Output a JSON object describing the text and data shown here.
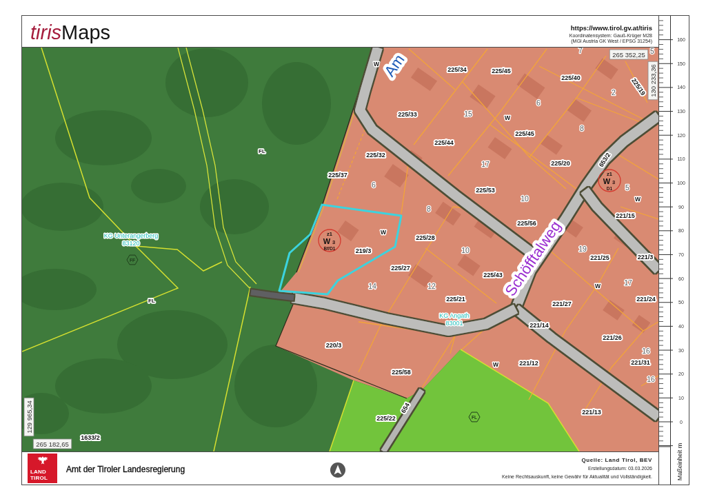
{
  "header": {
    "logo": {
      "prefix": "tiris",
      "suffix": "Maps"
    },
    "url": "https://www.tirol.gv.at/tiris",
    "coordinate_system": [
      "Koordinatensystem: Gauß-Krüger M28",
      "(MGI Austria GK West / EPSG 31254)"
    ]
  },
  "map": {
    "street_labels": [
      {
        "text": "Am",
        "color": "#1e5bb8"
      },
      {
        "text": "Schöfftalweg",
        "color": "#9a2fd0"
      }
    ],
    "labels": [
      {
        "kind": "house",
        "text": "7"
      },
      {
        "kind": "house",
        "text": "5"
      },
      {
        "kind": "zone",
        "text": "W"
      },
      {
        "kind": "parcel",
        "text": "225/34"
      },
      {
        "kind": "parcel",
        "text": "225/45"
      },
      {
        "kind": "parcel",
        "text": "225/40"
      },
      {
        "kind": "parcel",
        "text": "225/19"
      },
      {
        "kind": "house",
        "text": "2"
      },
      {
        "kind": "house",
        "text": "6"
      },
      {
        "kind": "parcel",
        "text": "225/33"
      },
      {
        "kind": "house",
        "text": "15"
      },
      {
        "kind": "zone",
        "text": "W"
      },
      {
        "kind": "house",
        "text": "8"
      },
      {
        "kind": "parcel",
        "text": "225/45"
      },
      {
        "kind": "parcel",
        "text": "225/44"
      },
      {
        "kind": "code",
        "text": "FL"
      },
      {
        "kind": "parcel",
        "text": "225/32"
      },
      {
        "kind": "house",
        "text": "17"
      },
      {
        "kind": "parcel",
        "text": "225/20"
      },
      {
        "kind": "parcel",
        "text": "653/2"
      },
      {
        "kind": "parcel",
        "text": "225/37"
      },
      {
        "kind": "house",
        "text": "6"
      },
      {
        "kind": "parcel",
        "text": "225/53"
      },
      {
        "kind": "house",
        "text": "5"
      },
      {
        "kind": "house",
        "text": "10"
      },
      {
        "kind": "zone",
        "text": "W"
      },
      {
        "kind": "house",
        "text": "8"
      },
      {
        "kind": "parcel",
        "text": "221/15"
      },
      {
        "kind": "parcel",
        "text": "225/56"
      },
      {
        "kind": "zone",
        "text": "W"
      },
      {
        "kind": "parcel",
        "text": "225/28"
      },
      {
        "kind": "parcel",
        "text": "219/3"
      },
      {
        "kind": "house",
        "text": "10"
      },
      {
        "kind": "house",
        "text": "19"
      },
      {
        "kind": "parcel",
        "text": "221/25"
      },
      {
        "kind": "parcel",
        "text": "221/3"
      },
      {
        "kind": "parcel",
        "text": "225/27"
      },
      {
        "kind": "parcel",
        "text": "225/43"
      },
      {
        "kind": "house",
        "text": "14"
      },
      {
        "kind": "house",
        "text": "12"
      },
      {
        "kind": "zone",
        "text": "W"
      },
      {
        "kind": "house",
        "text": "17"
      },
      {
        "kind": "code",
        "text": "FL"
      },
      {
        "kind": "parcel",
        "text": "225/21"
      },
      {
        "kind": "parcel",
        "text": "221/27"
      },
      {
        "kind": "parcel",
        "text": "221/24"
      },
      {
        "kind": "parcel",
        "text": "221/14"
      },
      {
        "kind": "parcel",
        "text": "220/3"
      },
      {
        "kind": "parcel",
        "text": "221/26"
      },
      {
        "kind": "house",
        "text": "16"
      },
      {
        "kind": "zone",
        "text": "W"
      },
      {
        "kind": "parcel",
        "text": "221/12"
      },
      {
        "kind": "parcel",
        "text": "221/31"
      },
      {
        "kind": "parcel",
        "text": "225/58"
      },
      {
        "kind": "house",
        "text": "16"
      },
      {
        "kind": "parcel",
        "text": "225/22"
      },
      {
        "kind": "parcel",
        "text": "654"
      },
      {
        "kind": "parcel",
        "text": "221/13"
      },
      {
        "kind": "parcel",
        "text": "1633/2"
      }
    ],
    "zoning_markers": [
      {
        "zone": "z1",
        "category": "W",
        "density": "3",
        "type": "D1"
      },
      {
        "zone": "z1",
        "category": "W",
        "density": "3",
        "type": "Bf/D1"
      }
    ],
    "land_use_markers": [
      {
        "code": "FF"
      },
      {
        "code": "FL"
      }
    ],
    "district_labels": [
      {
        "name": "KG Unterangerberg",
        "code": "83120"
      },
      {
        "name": "KG Angath",
        "code": "83001"
      }
    ],
    "coordinates": [
      {
        "text": "265 352,25"
      },
      {
        "text": "130 233,36"
      },
      {
        "text": "129 965,34"
      },
      {
        "text": "265 182,65"
      }
    ]
  },
  "scale": {
    "values": [
      "160",
      "150",
      "140",
      "130",
      "120",
      "110",
      "100",
      "90",
      "80",
      "70",
      "60",
      "50",
      "40",
      "30",
      "20",
      "10",
      "0"
    ],
    "unit": "Maßeinheit m"
  },
  "footer": {
    "emblem": {
      "lines": [
        "LAND",
        "TIROL"
      ]
    },
    "agency": "Amt der Tiroler Landesregierung",
    "source": "Quelle: Land Tirol, BEV",
    "created": "Erstellungsdatum: 03.03.2026",
    "disclaimer": "Keine Rechtsauskunft, keine Gewähr für Aktualität und Vollständigkeit."
  }
}
